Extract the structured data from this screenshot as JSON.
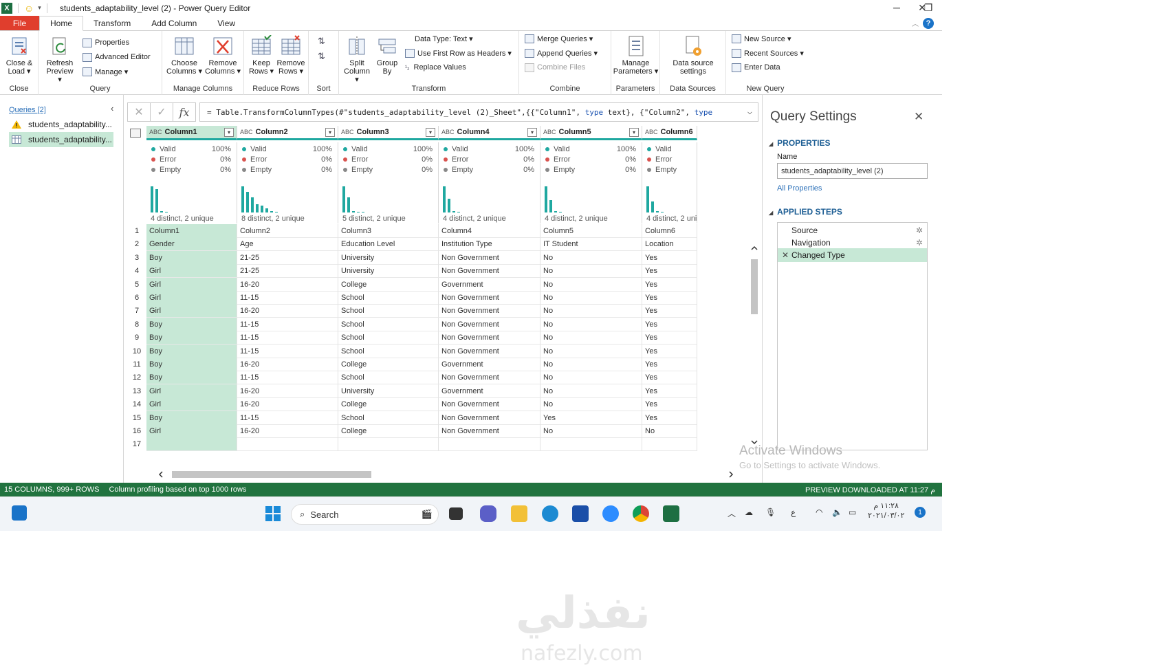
{
  "window": {
    "title": "students_adaptability_level (2) - Power Query Editor",
    "minimize": "─",
    "restore": "❐",
    "close": "✕"
  },
  "tabs": [
    "File",
    "Home",
    "Transform",
    "Add Column",
    "View"
  ],
  "ribbon": {
    "close_group": {
      "label": "Close",
      "close_load": "Close &",
      "close_load2": "Load ▾"
    },
    "query_group": {
      "label": "Query",
      "refresh": "Refresh",
      "refresh2": "Preview ▾",
      "properties": "Properties",
      "advanced_editor": "Advanced Editor",
      "manage": "Manage ▾"
    },
    "manage_columns": {
      "label": "Manage Columns",
      "choose": "Choose",
      "choose2": "Columns ▾",
      "remove": "Remove",
      "remove2": "Columns ▾"
    },
    "reduce_rows": {
      "label": "Reduce Rows",
      "keep": "Keep",
      "keep2": "Rows ▾",
      "remove": "Remove",
      "remove2": "Rows ▾"
    },
    "sort": {
      "label": "Sort"
    },
    "transform": {
      "label": "Transform",
      "split": "Split",
      "split2": "Column ▾",
      "group": "Group",
      "group2": "By",
      "data_type": "Data Type: Text ▾",
      "first_row": "Use First Row as Headers ▾",
      "replace": "Replace Values"
    },
    "combine": {
      "label": "Combine",
      "merge": "Merge Queries ▾",
      "append": "Append Queries ▾",
      "combine_files": "Combine Files"
    },
    "parameters": {
      "label": "Parameters",
      "manage": "Manage",
      "manage2": "Parameters ▾"
    },
    "data_sources": {
      "label": "Data Sources",
      "settings": "Data source",
      "settings2": "settings"
    },
    "new_query": {
      "label": "New Query",
      "new_source": "New Source ▾",
      "recent": "Recent Sources ▾",
      "enter_data": "Enter Data"
    }
  },
  "queries": {
    "header": "Queries [2]",
    "items": [
      "students_adaptability...",
      "students_adaptability..."
    ]
  },
  "formula": {
    "fx": "fx",
    "prefix": "= Table.TransformColumnTypes(#\"students_adaptability_level (2)_Sheet\",{{\"Column1\", ",
    "kw1": "type",
    "mid": " text}, {\"Column2\", ",
    "kw2": "type"
  },
  "columns": [
    {
      "name": "Column1",
      "valid": "100%",
      "error": "0%",
      "empty": "0%",
      "distinct": "4 distinct, 2 unique"
    },
    {
      "name": "Column2",
      "valid": "100%",
      "error": "0%",
      "empty": "0%",
      "distinct": "8 distinct, 2 unique"
    },
    {
      "name": "Column3",
      "valid": "100%",
      "error": "0%",
      "empty": "0%",
      "distinct": "5 distinct, 2 unique"
    },
    {
      "name": "Column4",
      "valid": "100%",
      "error": "0%",
      "empty": "0%",
      "distinct": "4 distinct, 2 unique"
    },
    {
      "name": "Column5",
      "valid": "100%",
      "error": "0%",
      "empty": "0%",
      "distinct": "4 distinct, 2 unique"
    },
    {
      "name": "Column6",
      "valid": "",
      "error": "",
      "empty": "",
      "distinct": "4 distinct, 2 uni"
    }
  ],
  "profile_labels": {
    "valid": "Valid",
    "error": "Error",
    "empty": "Empty"
  },
  "rows": [
    [
      "1",
      "Column1",
      "Column2",
      "Column3",
      "Column4",
      "Column5",
      "Column6"
    ],
    [
      "2",
      "Gender",
      "Age",
      "Education Level",
      "Institution Type",
      "IT Student",
      "Location"
    ],
    [
      "3",
      "Boy",
      "21-25",
      "University",
      "Non Government",
      "No",
      "Yes"
    ],
    [
      "4",
      "Girl",
      "21-25",
      "University",
      "Non Government",
      "No",
      "Yes"
    ],
    [
      "5",
      "Girl",
      "16-20",
      "College",
      "Government",
      "No",
      "Yes"
    ],
    [
      "6",
      "Girl",
      "11-15",
      "School",
      "Non Government",
      "No",
      "Yes"
    ],
    [
      "7",
      "Girl",
      "16-20",
      "School",
      "Non Government",
      "No",
      "Yes"
    ],
    [
      "8",
      "Boy",
      "11-15",
      "School",
      "Non Government",
      "No",
      "Yes"
    ],
    [
      "9",
      "Boy",
      "11-15",
      "School",
      "Non Government",
      "No",
      "Yes"
    ],
    [
      "10",
      "Boy",
      "11-15",
      "School",
      "Non Government",
      "No",
      "Yes"
    ],
    [
      "11",
      "Boy",
      "16-20",
      "College",
      "Government",
      "No",
      "Yes"
    ],
    [
      "12",
      "Boy",
      "11-15",
      "School",
      "Non Government",
      "No",
      "Yes"
    ],
    [
      "13",
      "Girl",
      "16-20",
      "University",
      "Government",
      "No",
      "Yes"
    ],
    [
      "14",
      "Girl",
      "16-20",
      "College",
      "Non Government",
      "No",
      "Yes"
    ],
    [
      "15",
      "Boy",
      "11-15",
      "School",
      "Non Government",
      "Yes",
      "Yes"
    ],
    [
      "16",
      "Girl",
      "16-20",
      "College",
      "Non Government",
      "No",
      "No"
    ],
    [
      "17",
      "",
      "",
      "",
      "",
      "",
      ""
    ]
  ],
  "settings": {
    "title": "Query Settings",
    "properties": "PROPERTIES",
    "name_label": "Name",
    "name_value": "students_adaptability_level (2)",
    "all_properties": "All Properties",
    "applied_steps": "APPLIED STEPS",
    "steps": [
      "Source",
      "Navigation",
      "Changed Type"
    ]
  },
  "status": {
    "left": "15 COLUMNS, 999+ ROWS",
    "middle": "Column profiling based on top 1000 rows",
    "right": "PREVIEW DOWNLOADED AT 11:27 م"
  },
  "taskbar": {
    "search": "Search",
    "lang": "ع",
    "time": "١١:٢٨ م",
    "date": "٢٠٢١/٠٣/٠٢",
    "notif": "1"
  },
  "watermark": {
    "activate": "Activate Windows",
    "activate_sub": "Go to Settings to activate Windows.",
    "logo_ar": "نفذلي",
    "logo_en": "nafezly.com"
  },
  "colors": {
    "accent": "#1fa8a0",
    "selection": "#c7e8d6",
    "status_bar": "#21733f",
    "file_tab": "#e03e2d"
  }
}
